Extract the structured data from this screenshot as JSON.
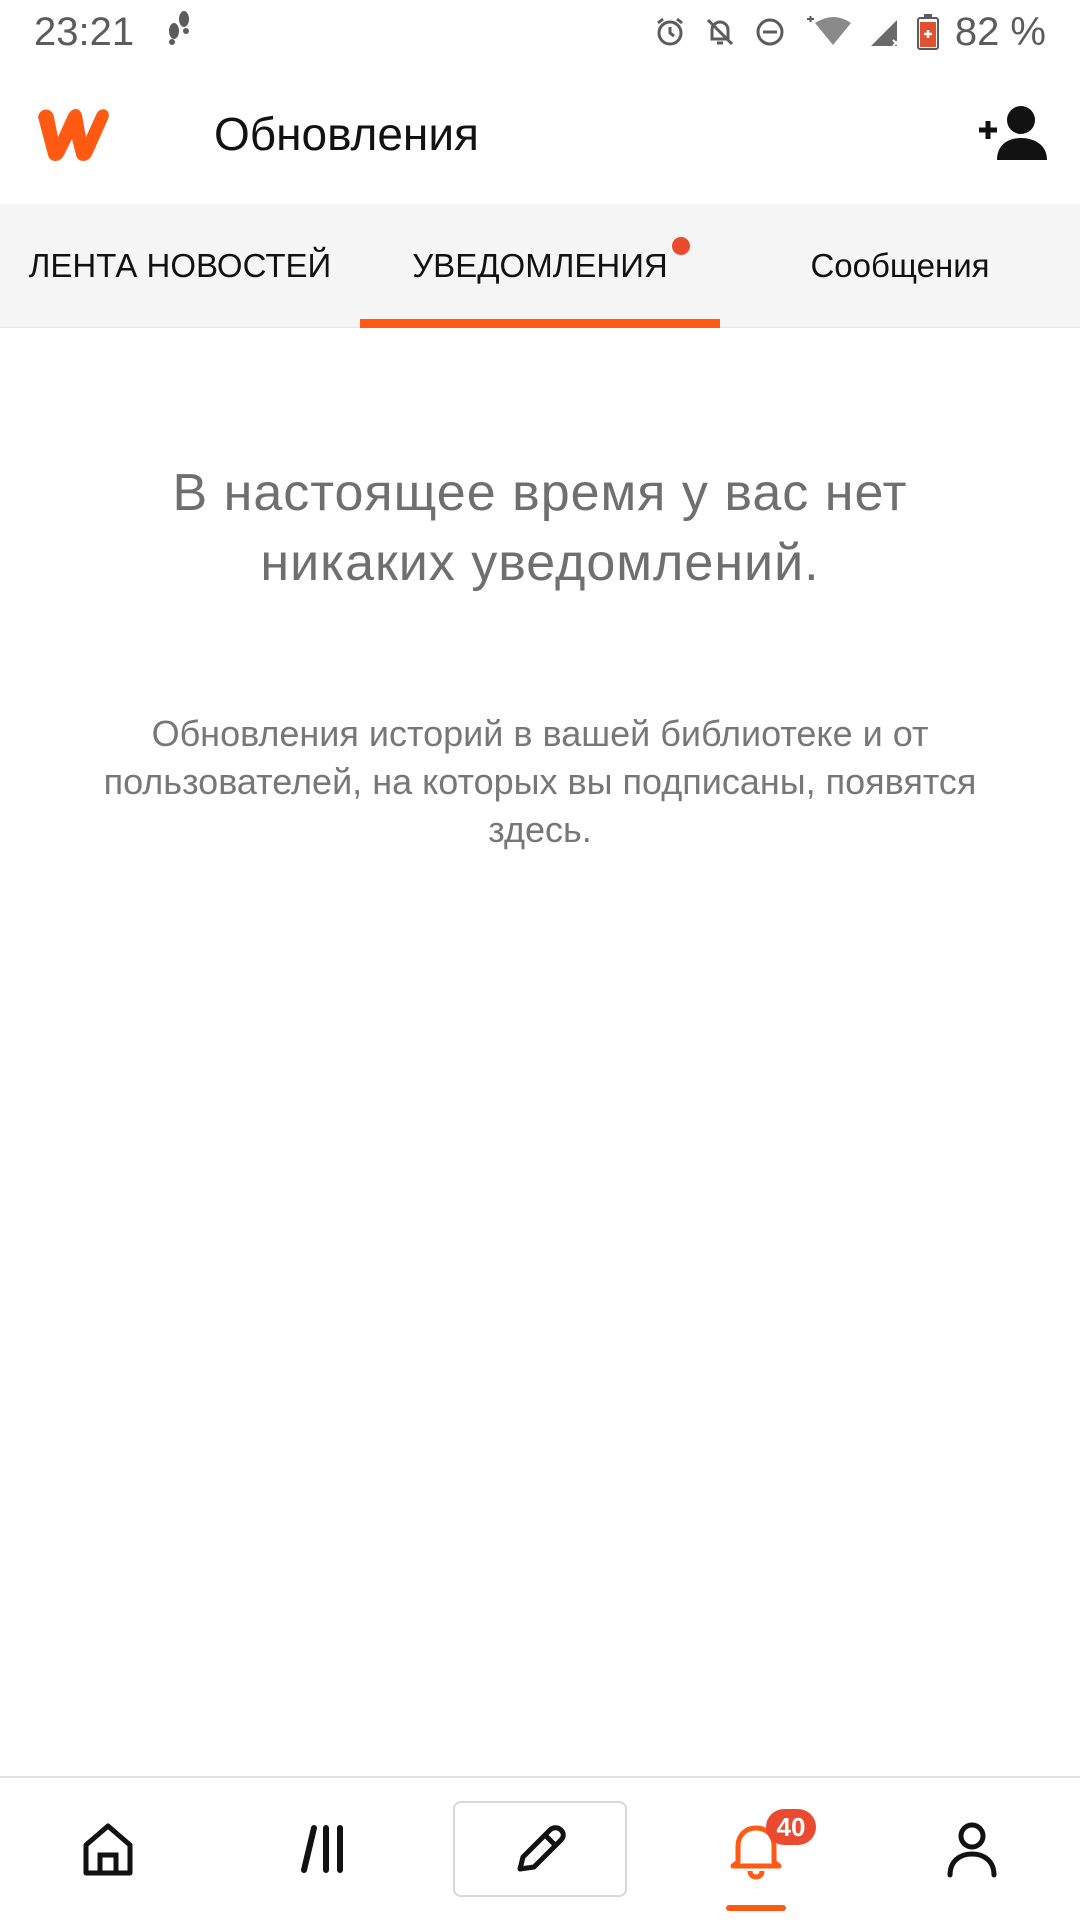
{
  "status_bar": {
    "time": "23:21",
    "battery": "82 %",
    "icons": [
      "footsteps-icon",
      "alarm-icon",
      "bell-off-icon",
      "do-not-disturb-icon",
      "wifi-icon",
      "signal-icon",
      "battery-icon"
    ]
  },
  "header": {
    "title": "Обновления",
    "logo": "wattpad-logo",
    "action_icon": "add-user-icon"
  },
  "tabs": [
    {
      "label": "ЛЕНТА НОВОСТЕЙ",
      "active": false
    },
    {
      "label": "УВЕДОМЛЕНИЯ",
      "active": true,
      "dot": true
    },
    {
      "label": "Сообщения",
      "active": false
    }
  ],
  "empty_state": {
    "title": "В настоящее время у вас нет никаких уведомлений.",
    "subtitle": "Обновления историй в вашей библиотеке и от пользователей, на которых вы подписаны, появятся здесь."
  },
  "bottom_nav": {
    "items": [
      "home-icon",
      "library-icon",
      "write-icon",
      "notifications-icon",
      "profile-icon"
    ],
    "notifications_badge": "40",
    "active": "notifications-icon"
  },
  "colors": {
    "accent": "#ff5a14",
    "badge": "#ea4a2f",
    "tab_background": "#f5f5f5",
    "muted_text": "#6f6f6f"
  }
}
